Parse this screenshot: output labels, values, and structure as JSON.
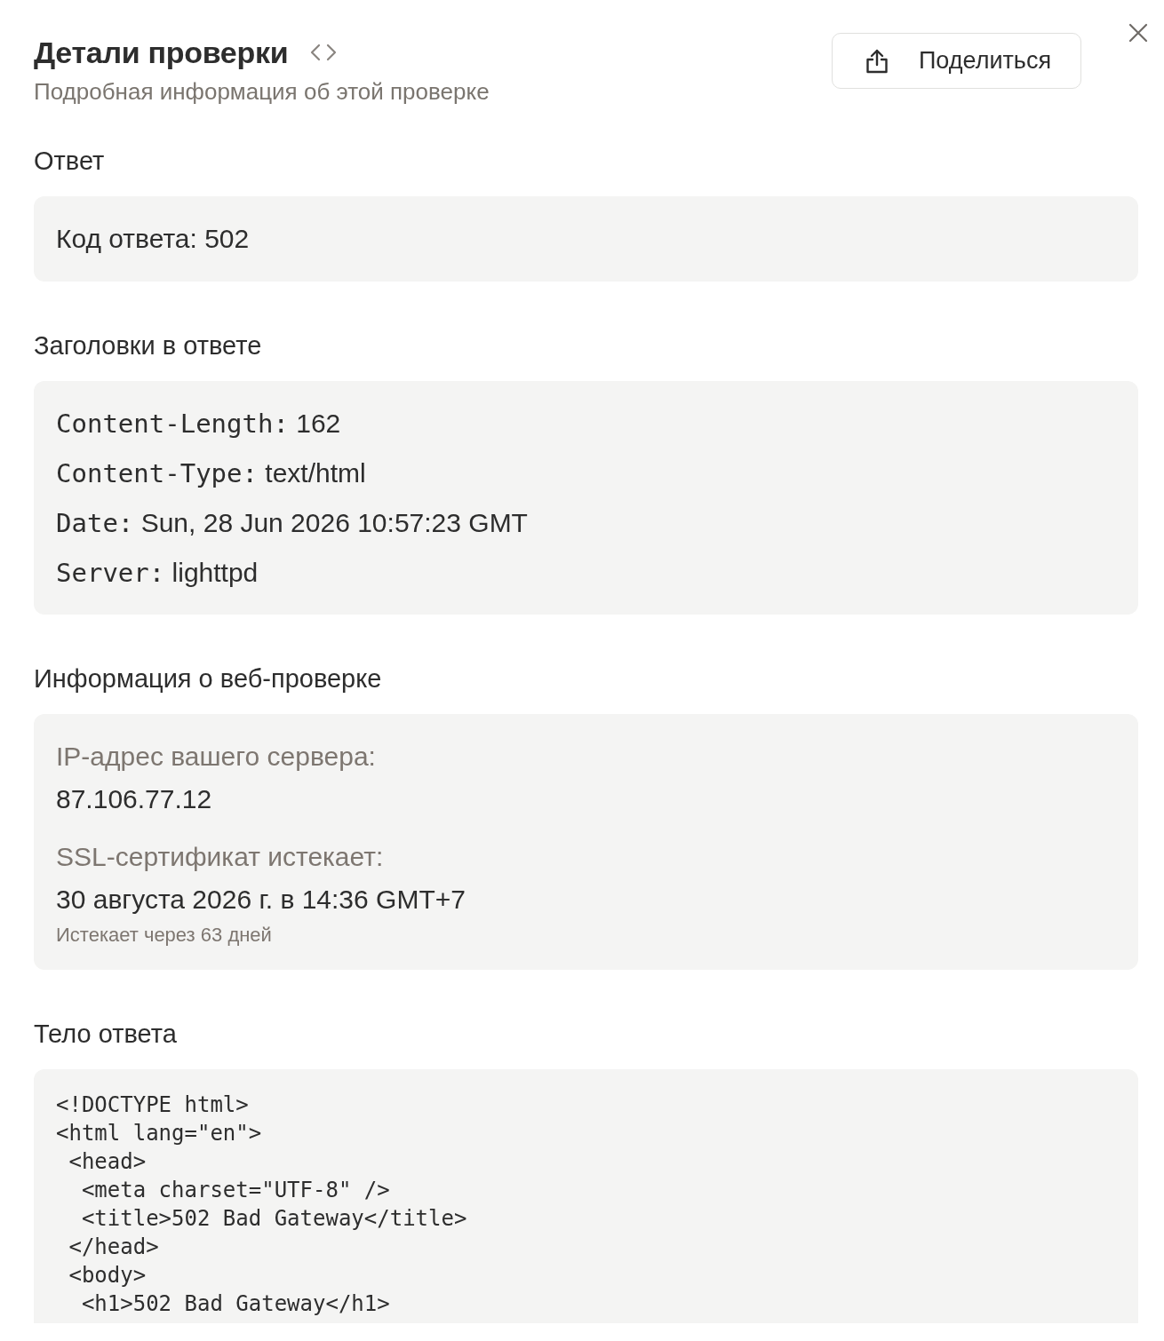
{
  "header": {
    "title": "Детали проверки",
    "subtitle": "Подробная информация об этой проверке",
    "share_button": "Поделиться"
  },
  "sections": [
    {
      "kind": "text",
      "heading": "Ответ",
      "text": "Код ответа: 502"
    },
    {
      "kind": "headers",
      "heading": "Заголовки в ответе",
      "headers": [
        {
          "name": "Content-Length:",
          "value": "162"
        },
        {
          "name": "Content-Type:",
          "value": "text/html"
        },
        {
          "name": "Date:",
          "value": "Sun, 28 Jun 2026 10:57:23 GMT"
        },
        {
          "name": "Server:",
          "value": "lighttpd"
        }
      ]
    },
    {
      "kind": "info",
      "heading": "Информация о веб-проверке",
      "fields": [
        {
          "label": "IP-адрес вашего сервера:",
          "value": "87.106.77.12"
        },
        {
          "label": "SSL-сертификат истекает:",
          "value": "30 августа 2026 г. в 14:36 GMT+7",
          "note": "Истекает через 63 дней"
        }
      ]
    },
    {
      "kind": "code",
      "heading": "Тело ответа",
      "lines": [
        "<!DOCTYPE html>",
        "<html lang=\"en\">",
        " <head>",
        "  <meta charset=\"UTF-8\" />",
        "  <title>502 Bad Gateway</title>",
        " </head>",
        " <body>",
        "  <h1>502 Bad Gateway</h1>"
      ]
    }
  ]
}
